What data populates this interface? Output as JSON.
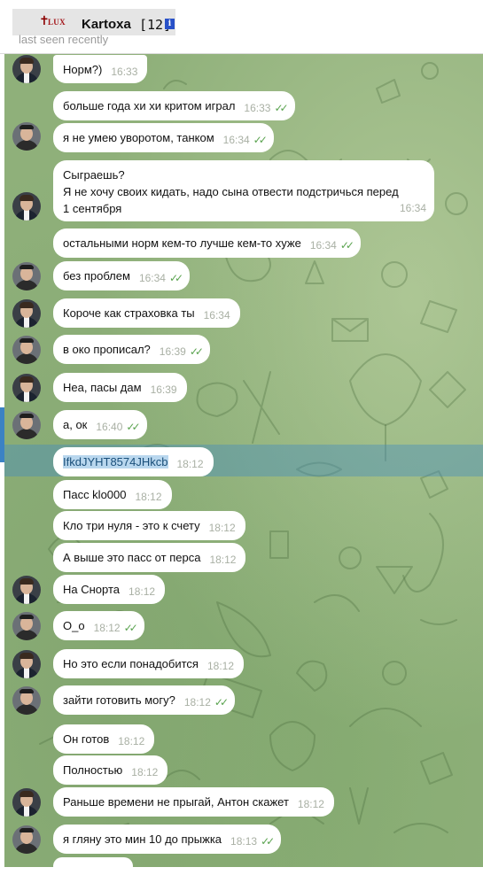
{
  "header": {
    "logo_text": "LUX",
    "name": "Kartoxa",
    "count": "[12]",
    "status": "last seen recently"
  },
  "colors": {
    "chat_background": "#8fb07a",
    "bubble": "#ffffff",
    "read_ticks": "#5aa34f",
    "selection": "#468cbe"
  },
  "messages": [
    {
      "text": "Норм?)",
      "time": "16:33",
      "ticks": false
    },
    {
      "text": "больше года хи хи критом играл",
      "time": "16:33",
      "ticks": true
    },
    {
      "text": "я не умею уворотом, танком",
      "time": "16:34",
      "ticks": true
    },
    {
      "text": "Сыграешь?\nЯ не хочу своих кидать, надо сына отвести подстричься перед 1 сентября",
      "time": "16:34",
      "ticks": false
    },
    {
      "text": "остальными норм кем-то лучше кем-то хуже",
      "time": "16:34",
      "ticks": true
    },
    {
      "text": "без проблем",
      "time": "16:34",
      "ticks": true
    },
    {
      "text": "Короче как страховка ты",
      "time": "16:34",
      "ticks": false
    },
    {
      "text": "в око прописал?",
      "time": "16:39",
      "ticks": true
    },
    {
      "text": "Неа, пасы дам",
      "time": "16:39",
      "ticks": false
    },
    {
      "text": "а, ок",
      "time": "16:40",
      "ticks": true
    },
    {
      "text": "IfkdJYHT8574JHkcb",
      "time": "18:12",
      "ticks": false
    },
    {
      "text": "Пасс klo000",
      "time": "18:12",
      "ticks": false
    },
    {
      "text": "Кло три нуля - это к счету",
      "time": "18:12",
      "ticks": false
    },
    {
      "text": "А выше это пасс от перса",
      "time": "18:12",
      "ticks": false
    },
    {
      "text": "На Снорта",
      "time": "18:12",
      "ticks": false
    },
    {
      "text": "О_о",
      "time": "18:12",
      "ticks": true
    },
    {
      "text": "Но это если понадобится",
      "time": "18:12",
      "ticks": false
    },
    {
      "text": "зайти готовить могу?",
      "time": "18:12",
      "ticks": true
    },
    {
      "text": "Он готов",
      "time": "18:12",
      "ticks": false
    },
    {
      "text": "Полностью",
      "time": "18:12",
      "ticks": false
    },
    {
      "text": "Раньше времени не прыгай, Антон скажет",
      "time": "18:12",
      "ticks": false
    },
    {
      "text": "я гляну это мин 10 до прыжка",
      "time": "18:13",
      "ticks": true
    }
  ]
}
